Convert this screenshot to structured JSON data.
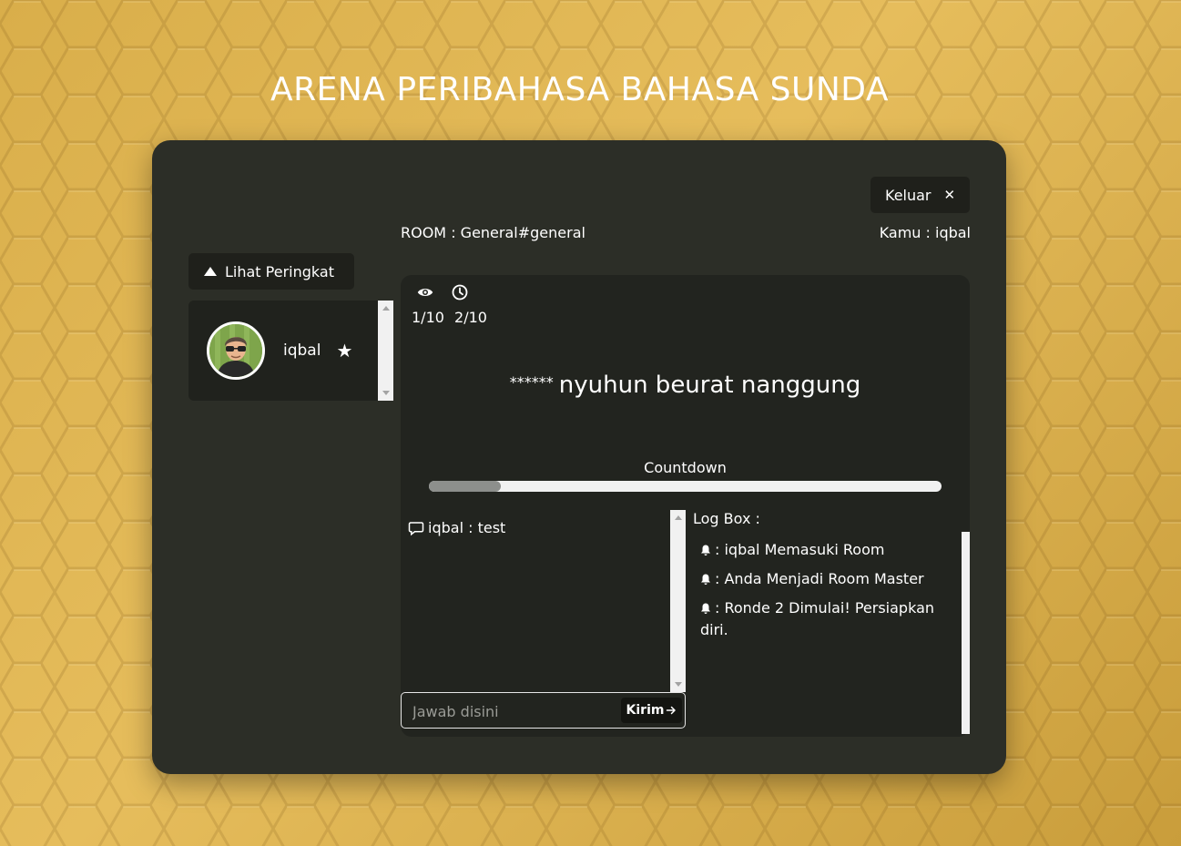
{
  "page_title": "ARENA PERIBAHASA BAHASA SUNDA",
  "header": {
    "exit_label": "Keluar",
    "exit_icon": "close-icon",
    "room_label": "ROOM : General#general",
    "user_label": "Kamu : iqbal"
  },
  "leaderboard": {
    "toggle_label": "Lihat Peringkat",
    "toggle_icon": "triangle-up-icon",
    "players": [
      {
        "name": "iqbal",
        "badge_icon": "star-icon",
        "avatar_icon": "user-avatar"
      }
    ]
  },
  "game": {
    "stats": [
      {
        "icon": "eye-icon",
        "value": "1/10"
      },
      {
        "icon": "clock-icon",
        "value": "2/10"
      }
    ],
    "question_mask": "******",
    "question_text": "nyuhun beurat nanggung",
    "countdown_label": "Countdown",
    "countdown_fraction": 0.14
  },
  "chat": {
    "messages": [
      {
        "icon": "chat-bubble-icon",
        "text": "iqbal : test"
      }
    ],
    "input_placeholder": "Jawab disini",
    "input_value": "",
    "send_label": "Kirim"
  },
  "log": {
    "title": "Log Box :",
    "items": [
      {
        "icon": "bell-icon",
        "text": ": iqbal Memasuki Room"
      },
      {
        "icon": "bell-icon",
        "text": ": Anda Menjadi Room Master"
      },
      {
        "icon": "bell-icon",
        "text": ": Ronde 2 Dimulai! Persiapkan diri."
      }
    ]
  },
  "colors": {
    "background": "#e0b552",
    "panel": "#2c2e27",
    "card": "#22241f",
    "text": "#ffffff"
  }
}
